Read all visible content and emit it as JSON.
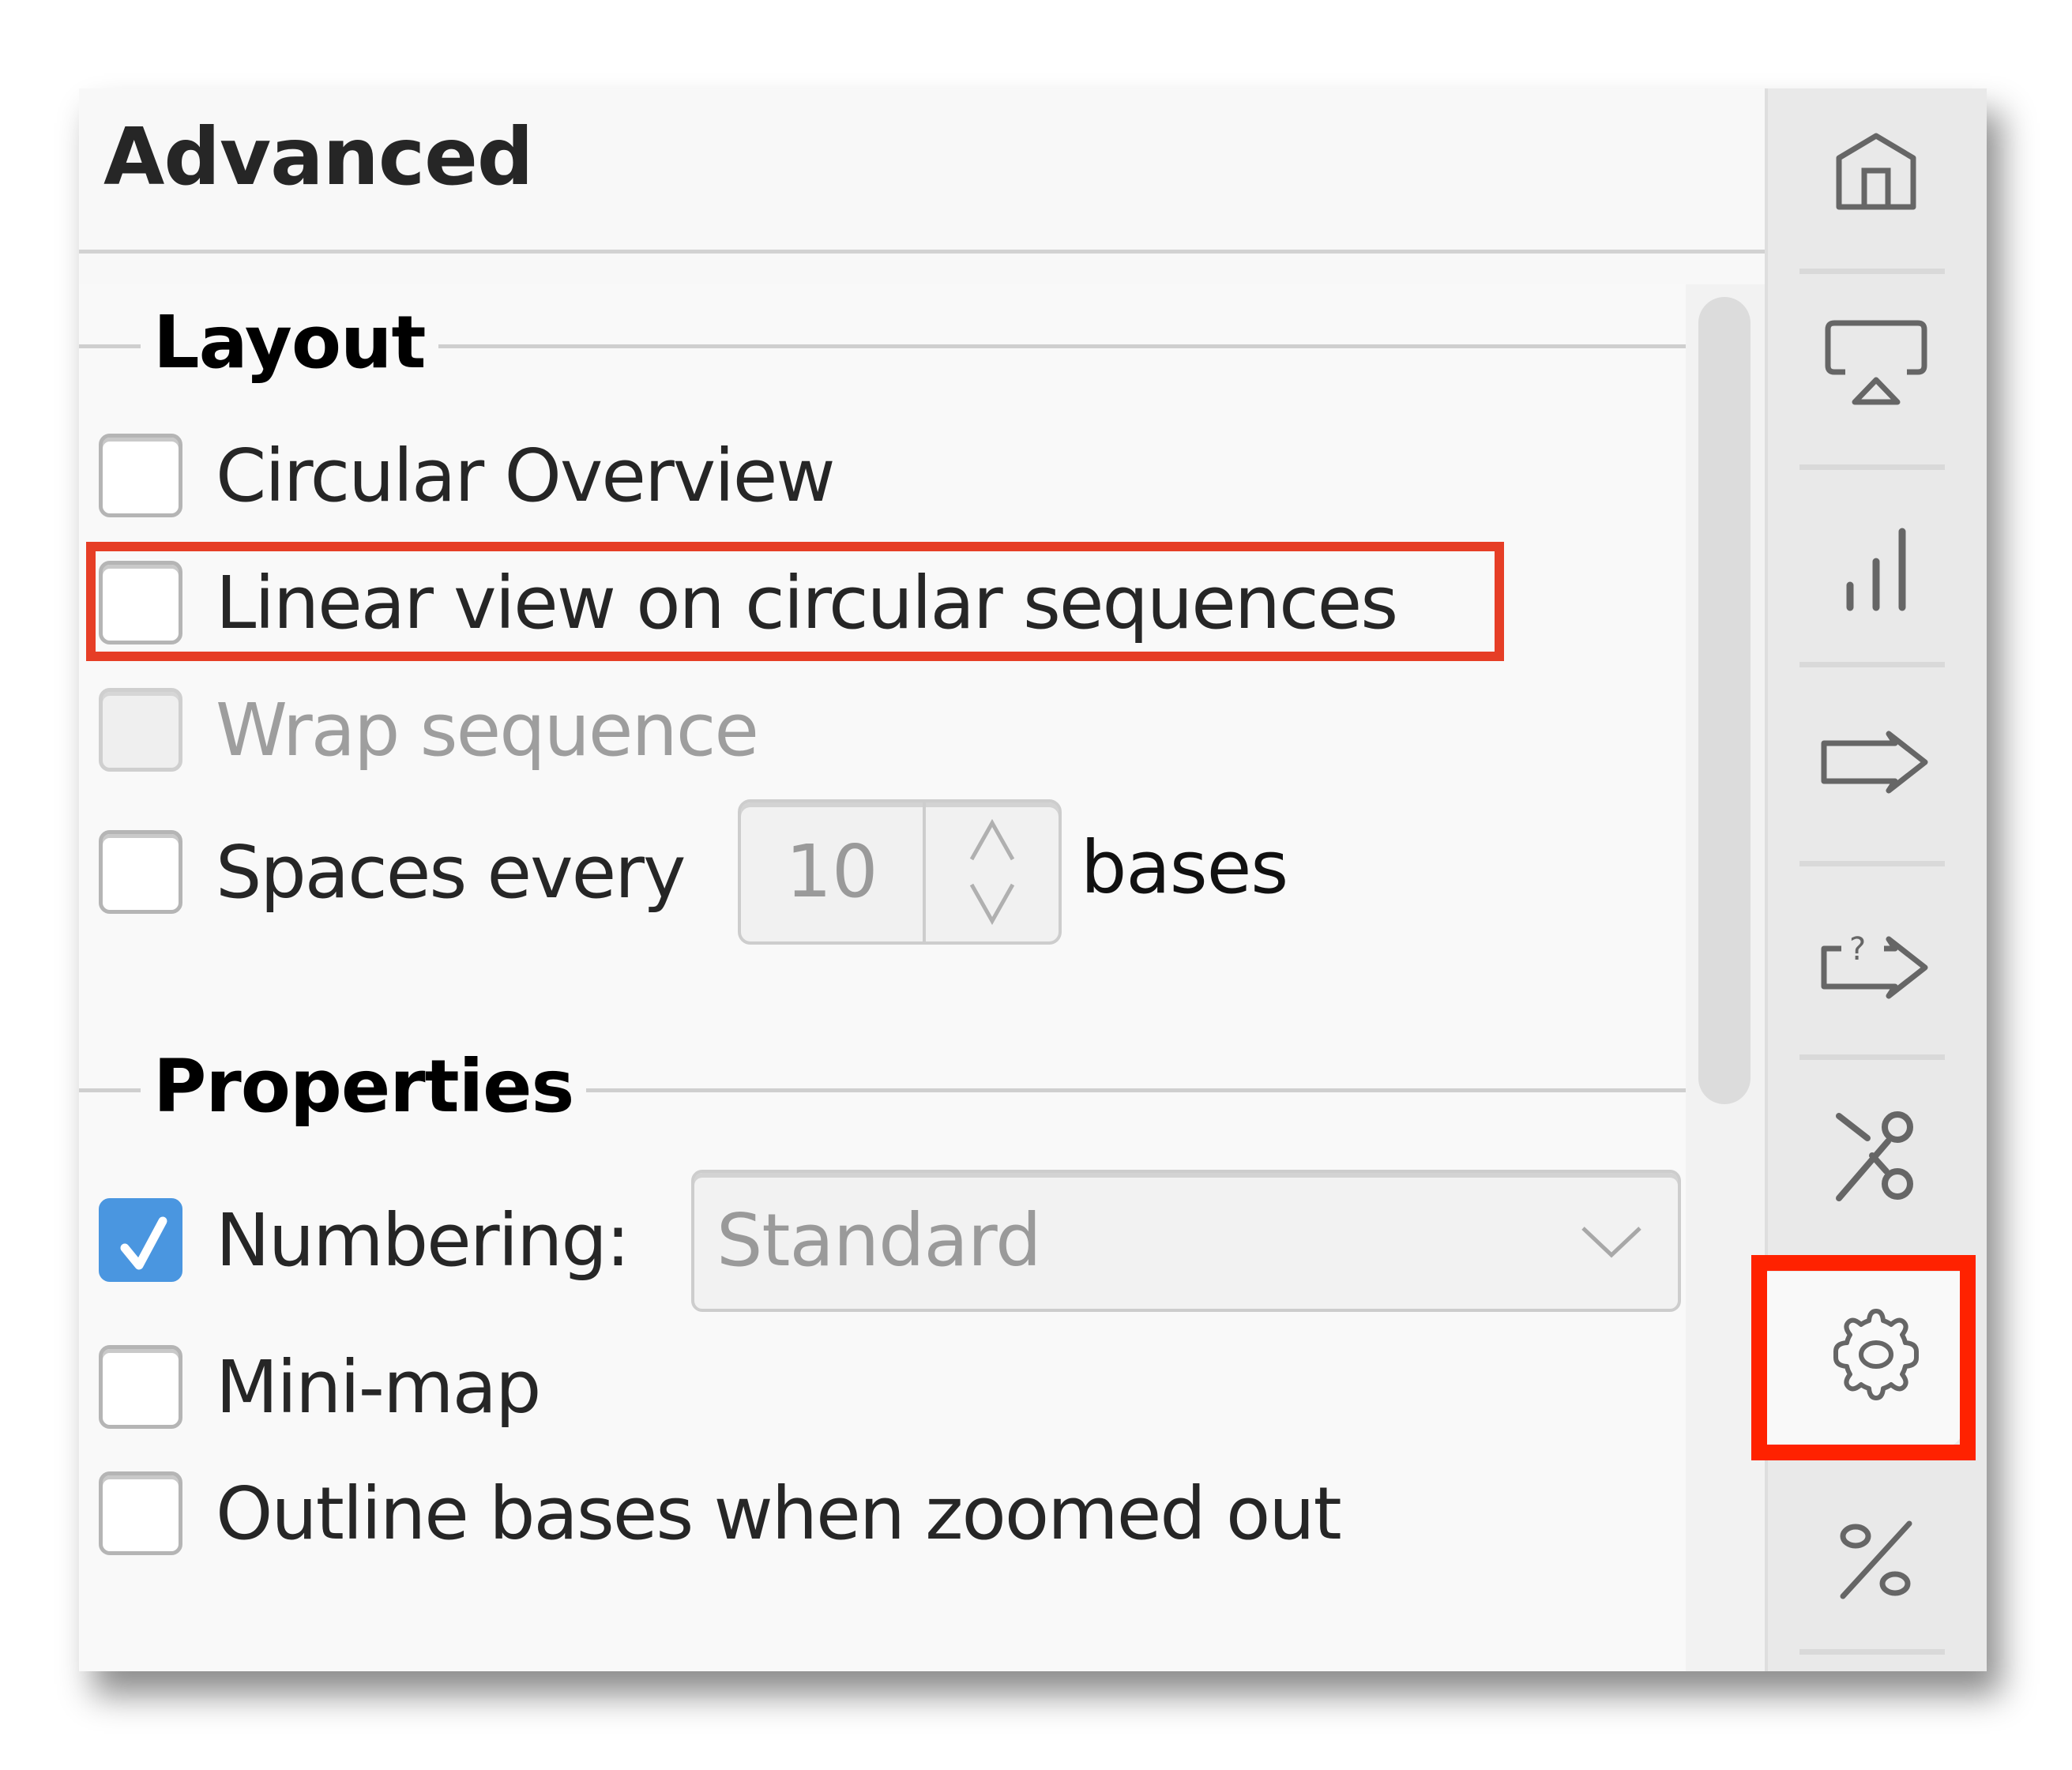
{
  "header": {
    "title": "Advanced"
  },
  "sections": {
    "layout": {
      "title": "Layout",
      "circular_overview": {
        "label": "Circular Overview",
        "checked": false,
        "enabled": true
      },
      "linear_view": {
        "label": "Linear view on circular sequences",
        "checked": false,
        "enabled": true,
        "highlighted": true
      },
      "wrap_sequence": {
        "label": "Wrap sequence",
        "checked": false,
        "enabled": false
      },
      "spaces_every": {
        "label": "Spaces every",
        "checked": false,
        "value": "10",
        "suffix": "bases"
      }
    },
    "properties": {
      "title": "Properties",
      "numbering": {
        "label": "Numbering:",
        "checked": true,
        "selected": "Standard"
      },
      "mini_map": {
        "label": "Mini-map",
        "checked": false
      },
      "outline_bases": {
        "label": "Outline bases when zoomed out",
        "checked": false
      }
    }
  },
  "rail": {
    "items": [
      {
        "icon": "home-icon",
        "active": false
      },
      {
        "icon": "airplay-display-icon",
        "active": false
      },
      {
        "icon": "bar-chart-icon",
        "active": false
      },
      {
        "icon": "arrow-right-outline-icon",
        "active": false
      },
      {
        "icon": "unknown-arrow-icon",
        "active": false
      },
      {
        "icon": "scissors-icon",
        "active": false
      },
      {
        "icon": "gear-icon",
        "active": true,
        "highlighted": true
      },
      {
        "icon": "percent-icon",
        "active": false
      }
    ]
  },
  "colors": {
    "accent_checkbox": "#4a96e0",
    "highlight_red": "#e63e26",
    "highlight_red_rail": "#ff2200"
  }
}
